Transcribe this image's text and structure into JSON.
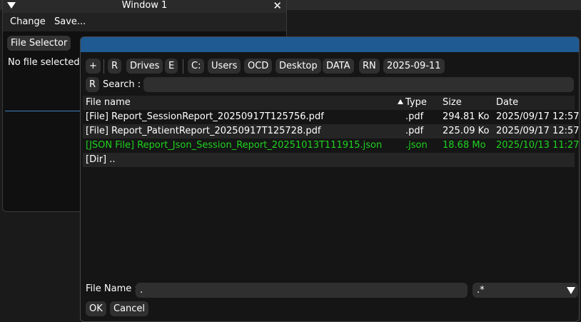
{
  "window1": {
    "title": "Window 1",
    "close_glyph": "✕",
    "menu": [
      "Change",
      "Save..."
    ],
    "file_selector_label": "File Selector",
    "status_text": "No file selected"
  },
  "dialog": {
    "path_buttons": [
      "+",
      "R",
      "Drives",
      "E",
      "C:",
      "Users",
      "OCD",
      "Desktop",
      "DATA",
      "RN",
      "2025-09-11"
    ],
    "search": {
      "reset_label": "R",
      "label": "Search :",
      "value": ""
    },
    "columns": {
      "name": "File name",
      "type": "Type",
      "size": "Size",
      "date": "Date"
    },
    "rows": [
      {
        "name": "[File] Report_SessionReport_20250917T125756.pdf",
        "type": ".pdf",
        "size": "294.81 Ko",
        "date": "2025/09/17 12:57",
        "color": "#ffffff"
      },
      {
        "name": "[File] Report_PatientReport_20250917T125728.pdf",
        "type": ".pdf",
        "size": "225.09 Ko",
        "date": "2025/09/17 12:57",
        "color": "#ffffff"
      },
      {
        "name": "[JSON File] Report_Json_Session_Report_20251013T111915.json",
        "type": ".json",
        "size": "18.68 Mo",
        "date": "2025/10/13 11:27",
        "color": "#1fd31f"
      },
      {
        "name": "[Dir] ..",
        "type": "",
        "size": "",
        "date": "",
        "color": "#ffffff"
      }
    ],
    "file_name_label": "File Name :",
    "file_name_value": ".",
    "filter_value": ".*",
    "ok_label": "OK",
    "cancel_label": "Cancel"
  },
  "colors": {
    "title_bar": "#1f5a93",
    "json_highlight": "#1fd31f",
    "row_alt": "#252525"
  }
}
